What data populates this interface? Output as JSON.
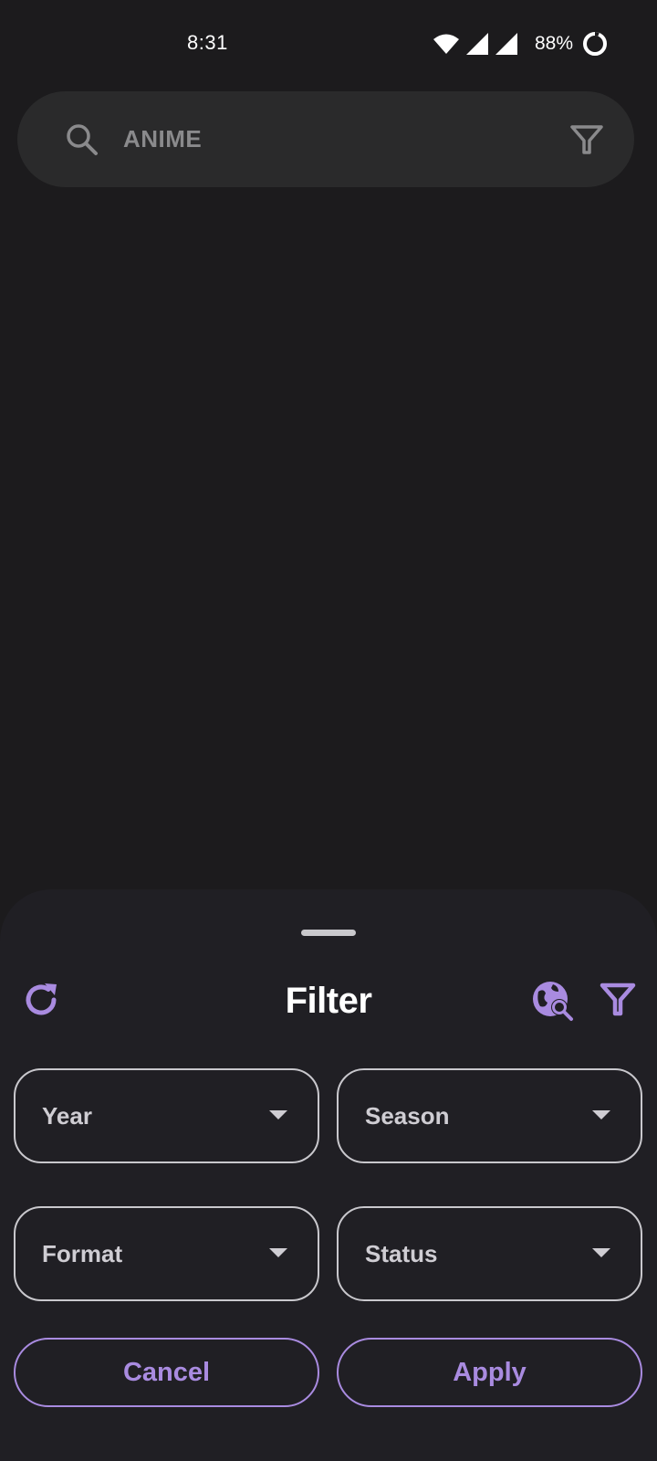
{
  "status_bar": {
    "time": "8:31",
    "battery": "88%"
  },
  "search": {
    "text": "ANIME"
  },
  "sheet": {
    "title": "Filter",
    "dropdowns": [
      {
        "label": "Year"
      },
      {
        "label": "Season"
      },
      {
        "label": "Format"
      },
      {
        "label": "Status"
      }
    ],
    "cancel_label": "Cancel",
    "apply_label": "Apply"
  },
  "colors": {
    "background": "#1c1b1d",
    "sheet": "#201f24",
    "accent": "#a98be0",
    "search_bg": "#2a2a2b"
  },
  "icons": [
    "search-icon",
    "filter-icon",
    "reset-icon",
    "globe-search-icon",
    "wifi-icon",
    "signal-icon",
    "battery-icon",
    "chevron-down-icon"
  ]
}
